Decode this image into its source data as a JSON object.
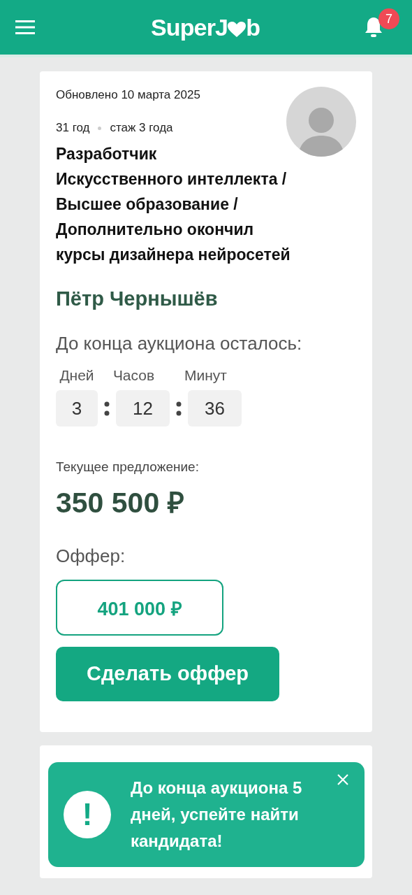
{
  "header": {
    "logo_start": "SuperJ",
    "logo_end": "b",
    "notification_count": "7"
  },
  "cards": [
    {
      "updated": "Обновлено 10 марта 2025",
      "age": "31 год",
      "experience": "стаж 3 года",
      "title_lines": [
        "Разработчик",
        "Искусственного интеллекта /",
        "Высшее образование /",
        "Дополнительно окончил",
        "курсы дизайнера нейросетей"
      ],
      "name": "Пётр Чернышёв",
      "auction_label": "До конца аукциона осталось:",
      "timer": [
        {
          "unit": "Дней",
          "value": "3"
        },
        {
          "unit": "Часов",
          "value": "12"
        },
        {
          "unit": "Минут",
          "value": "36"
        }
      ],
      "current_label": "Текущее предложение:",
      "current_price": "350 500 ₽",
      "offer_label": "Оффер:",
      "offer_value": "401 000 ₽",
      "offer_button": "Сделать оффер"
    }
  ],
  "toast": {
    "message": "До конца аукциона 5 дней, успейте найти кандидата!",
    "icon": "!"
  }
}
